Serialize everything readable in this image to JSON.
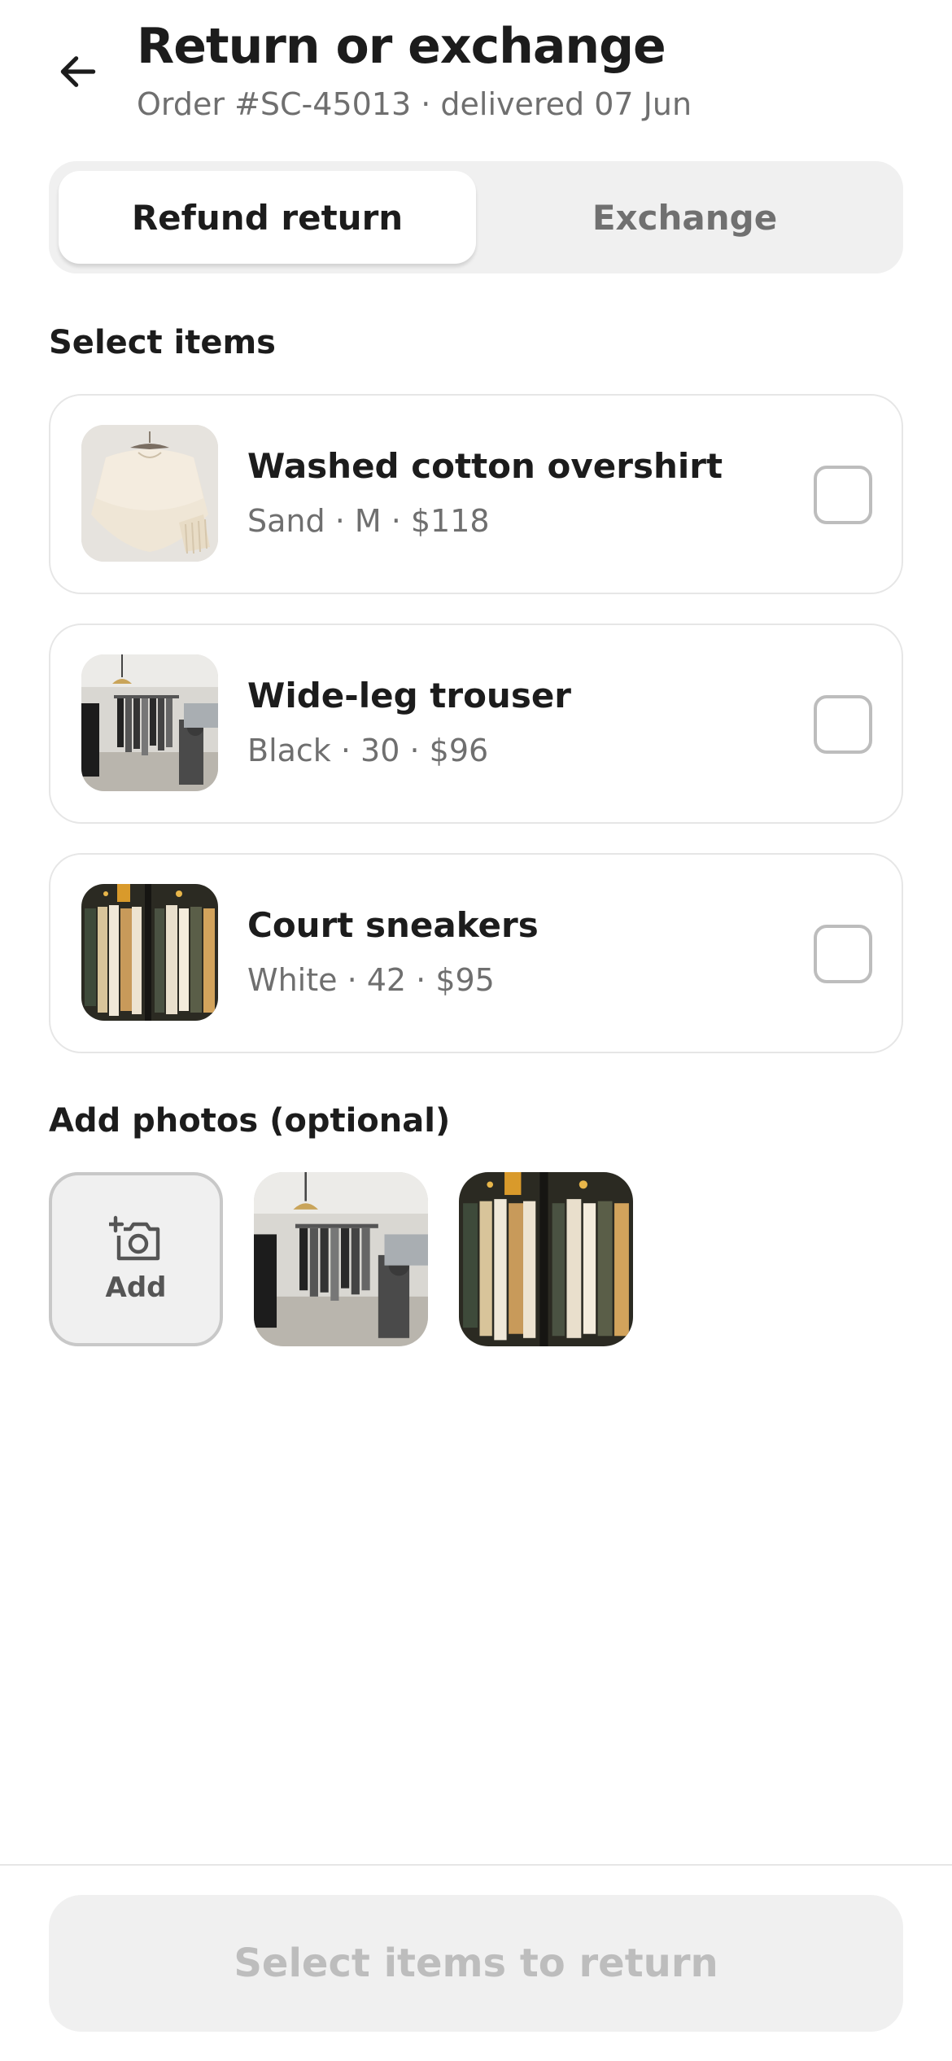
{
  "header": {
    "title": "Return or exchange",
    "subtitle": "Order #SC-45013 · delivered 07 Jun",
    "back_icon": "arrow-left-icon"
  },
  "mode_tabs": [
    {
      "label": "Refund return",
      "selected": true
    },
    {
      "label": "Exchange",
      "selected": false
    }
  ],
  "items_section": {
    "label": "Select items",
    "items": [
      {
        "name": "Washed cotton overshirt",
        "meta": "Sand · M · $118",
        "checked": false
      },
      {
        "name": "Wide-leg trouser",
        "meta": "Black · 30 · $96",
        "checked": false
      },
      {
        "name": "Court sneakers",
        "meta": "White · 42 · $95",
        "checked": false
      }
    ]
  },
  "photos_section": {
    "label": "Add photos (optional)",
    "add_label": "Add",
    "add_icon": "add-photo-icon"
  },
  "footer": {
    "cta_label": "Select items to return"
  },
  "colors": {
    "text_primary": "#1c1c1c",
    "text_secondary": "#6f6f6f",
    "surface_gray": "#f0f0f0",
    "border": "#e6e6e6",
    "disabled_text": "#bdbdbd"
  }
}
